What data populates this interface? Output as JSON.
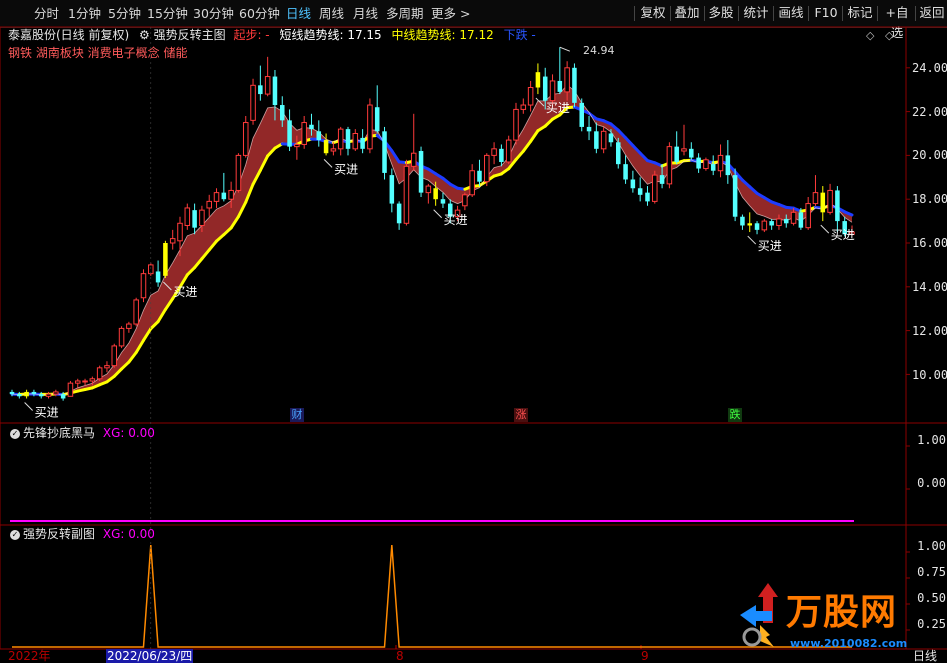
{
  "toolbar": {
    "periods": [
      "分时",
      "1分钟",
      "5分钟",
      "15分钟",
      "30分钟",
      "60分钟",
      "日线",
      "周线",
      "月线",
      "多周期",
      "更多 >"
    ],
    "active_period": "日线",
    "right_buttons": [
      "复权",
      "叠加",
      "多股",
      "统计",
      "画线",
      "F10",
      "标记",
      "+自选",
      "返回"
    ]
  },
  "main_panel": {
    "stock": "泰嘉股份(日线 前复权)",
    "indicator": "强势反转主图",
    "start_label": "起步: -",
    "short_trend": "短线趋势线: 17.15",
    "mid_trend": "中线趋势线: 17.12",
    "direction": "下跌 -",
    "concepts": "钢铁 湖南板块 消费电子概念 储能",
    "y_axis": [
      "24.00",
      "22.00",
      "20.00",
      "18.00",
      "16.00",
      "14.00",
      "12.00",
      "10.00"
    ],
    "peak_label": "24.94",
    "buy_label": "买进",
    "news_marks": [
      "财",
      "涨",
      "跌"
    ]
  },
  "sub_panel_1": {
    "title": "先锋抄底黑马",
    "xg": "XG: 0.00",
    "y_axis": [
      "1.00",
      "0.00"
    ]
  },
  "sub_panel_2": {
    "title": "强势反转副图",
    "xg": "XG: 0.00",
    "y_axis": [
      "1.00",
      "0.75",
      "0.50",
      "0.25"
    ]
  },
  "x_axis": [
    "2022年",
    "2022/06/23/四",
    "8",
    "9"
  ],
  "footer_right": "日线",
  "watermark": {
    "brand": "万股网",
    "url": "www.2010082.com"
  },
  "colors": {
    "up": "#ff3b3b",
    "down": "#54ffff",
    "buy_bar": "#ffff00",
    "trend_up": "#ffff00",
    "trend_down": "#1e3cff",
    "band": "#9a2a2a",
    "magenta": "#ff00ff",
    "orange": "#ff8a00"
  },
  "chart_data": {
    "type": "candlestick",
    "title": "泰嘉股份(日线 前复权)",
    "ylim": [
      9,
      25
    ],
    "ohlc": [
      [
        9.2,
        9.3,
        9.0,
        9.1
      ],
      [
        9.1,
        9.2,
        8.9,
        9.0
      ],
      [
        9.0,
        9.3,
        8.9,
        9.2
      ],
      [
        9.2,
        9.3,
        9.0,
        9.1
      ],
      [
        9.1,
        9.2,
        8.9,
        9.0
      ],
      [
        9.0,
        9.2,
        8.9,
        9.1
      ],
      [
        9.1,
        9.3,
        9.0,
        9.2
      ],
      [
        9.1,
        9.2,
        8.8,
        8.9
      ],
      [
        9.0,
        9.7,
        9.0,
        9.6
      ],
      [
        9.6,
        9.8,
        9.4,
        9.7
      ],
      [
        9.7,
        9.8,
        9.5,
        9.7
      ],
      [
        9.7,
        9.9,
        9.5,
        9.8
      ],
      [
        9.8,
        10.4,
        9.7,
        10.3
      ],
      [
        10.3,
        10.6,
        10.1,
        10.4
      ],
      [
        10.4,
        11.4,
        10.3,
        11.3
      ],
      [
        11.3,
        12.2,
        11.2,
        12.1
      ],
      [
        12.1,
        12.4,
        11.9,
        12.3
      ],
      [
        12.3,
        13.5,
        12.2,
        13.4
      ],
      [
        13.5,
        14.8,
        13.3,
        14.6
      ],
      [
        14.6,
        15.1,
        14.5,
        15.0
      ],
      [
        14.7,
        15.2,
        14.0,
        14.2
      ],
      [
        14.5,
        16.1,
        14.4,
        16.0
      ],
      [
        16.0,
        16.6,
        15.7,
        16.2
      ],
      [
        16.1,
        17.2,
        15.4,
        16.9
      ],
      [
        16.8,
        17.8,
        16.6,
        17.6
      ],
      [
        17.5,
        17.8,
        16.4,
        16.7
      ],
      [
        16.8,
        17.7,
        16.5,
        17.5
      ],
      [
        17.6,
        18.2,
        17.2,
        17.9
      ],
      [
        17.9,
        18.5,
        17.6,
        18.3
      ],
      [
        18.3,
        19.2,
        17.9,
        18.0
      ],
      [
        18.0,
        18.8,
        17.6,
        18.4
      ],
      [
        18.4,
        20.1,
        18.3,
        20.0
      ],
      [
        20.0,
        21.8,
        19.9,
        21.5
      ],
      [
        21.6,
        23.5,
        21.4,
        23.2
      ],
      [
        23.2,
        24.1,
        22.5,
        22.8
      ],
      [
        22.8,
        24.5,
        22.7,
        23.6
      ],
      [
        23.6,
        23.9,
        21.6,
        22.3
      ],
      [
        22.3,
        22.7,
        21.3,
        21.6
      ],
      [
        21.6,
        22.1,
        20.2,
        20.4
      ],
      [
        20.4,
        20.9,
        19.8,
        20.5
      ],
      [
        20.5,
        21.8,
        20.3,
        21.5
      ],
      [
        21.4,
        21.9,
        20.9,
        21.2
      ],
      [
        21.1,
        21.6,
        20.4,
        20.7
      ],
      [
        20.7,
        21.0,
        20.0,
        20.1
      ],
      [
        20.2,
        20.6,
        20.0,
        20.3
      ],
      [
        20.3,
        21.3,
        20.0,
        21.2
      ],
      [
        21.2,
        21.3,
        20.0,
        20.3
      ],
      [
        20.3,
        21.2,
        20.2,
        21.0
      ],
      [
        20.8,
        21.2,
        20.1,
        20.3
      ],
      [
        20.3,
        22.6,
        20.1,
        22.3
      ],
      [
        22.2,
        23.2,
        21.0,
        21.1
      ],
      [
        21.1,
        21.3,
        18.9,
        19.2
      ],
      [
        19.1,
        19.4,
        17.4,
        17.8
      ],
      [
        17.8,
        17.9,
        16.6,
        16.9
      ],
      [
        16.9,
        19.8,
        16.8,
        19.5
      ],
      [
        19.5,
        21.9,
        19.3,
        20.1
      ],
      [
        20.2,
        20.4,
        18.1,
        18.3
      ],
      [
        18.3,
        18.7,
        17.8,
        18.6
      ],
      [
        18.5,
        18.8,
        17.7,
        18.0
      ],
      [
        18.0,
        18.3,
        17.6,
        17.8
      ],
      [
        17.8,
        18.0,
        16.9,
        17.2
      ],
      [
        17.2,
        17.7,
        17.0,
        17.5
      ],
      [
        17.7,
        18.3,
        17.5,
        18.2
      ],
      [
        18.2,
        19.6,
        18.1,
        19.3
      ],
      [
        19.3,
        19.8,
        18.6,
        18.8
      ],
      [
        18.8,
        20.1,
        18.6,
        20.0
      ],
      [
        20.0,
        20.6,
        19.6,
        20.3
      ],
      [
        20.3,
        20.5,
        19.5,
        19.7
      ],
      [
        19.7,
        20.9,
        19.6,
        20.7
      ],
      [
        20.7,
        22.4,
        20.5,
        22.1
      ],
      [
        22.1,
        22.6,
        21.9,
        22.3
      ],
      [
        22.3,
        23.4,
        22.0,
        23.1
      ],
      [
        23.1,
        24.2,
        22.8,
        23.8
      ],
      [
        23.6,
        24.0,
        22.1,
        22.5
      ],
      [
        22.5,
        23.7,
        22.3,
        23.4
      ],
      [
        23.4,
        24.94,
        22.8,
        22.9
      ],
      [
        22.9,
        24.3,
        22.5,
        24.0
      ],
      [
        24.0,
        24.2,
        22.2,
        22.4
      ],
      [
        22.4,
        22.6,
        21.1,
        21.3
      ],
      [
        21.3,
        21.8,
        20.7,
        21.1
      ],
      [
        21.1,
        21.5,
        20.1,
        20.3
      ],
      [
        20.3,
        21.3,
        20.1,
        21.1
      ],
      [
        21.0,
        21.2,
        20.4,
        20.6
      ],
      [
        20.6,
        20.8,
        19.4,
        19.6
      ],
      [
        19.6,
        20.0,
        18.7,
        18.9
      ],
      [
        18.9,
        19.3,
        18.3,
        18.5
      ],
      [
        18.5,
        19.0,
        17.9,
        18.2
      ],
      [
        18.3,
        18.6,
        17.7,
        17.9
      ],
      [
        17.9,
        19.3,
        17.8,
        19.1
      ],
      [
        19.1,
        19.6,
        18.5,
        18.7
      ],
      [
        18.7,
        20.6,
        18.5,
        20.4
      ],
      [
        20.4,
        21.1,
        19.6,
        19.7
      ],
      [
        20.2,
        21.4,
        20.0,
        20.3
      ],
      [
        20.3,
        20.6,
        19.8,
        19.9
      ],
      [
        19.9,
        20.1,
        19.2,
        19.4
      ],
      [
        19.4,
        19.9,
        19.3,
        19.8
      ],
      [
        19.6,
        20.0,
        19.1,
        19.3
      ],
      [
        19.3,
        20.5,
        19.0,
        20.0
      ],
      [
        20.0,
        20.7,
        18.7,
        19.1
      ],
      [
        19.1,
        19.4,
        17.0,
        17.2
      ],
      [
        17.2,
        17.3,
        16.6,
        16.8
      ],
      [
        16.8,
        17.4,
        16.5,
        16.9
      ],
      [
        16.9,
        17.0,
        16.4,
        16.6
      ],
      [
        16.6,
        17.1,
        16.5,
        17.0
      ],
      [
        17.0,
        17.1,
        16.6,
        16.8
      ],
      [
        16.8,
        17.3,
        16.6,
        17.1
      ],
      [
        17.1,
        17.3,
        16.7,
        16.9
      ],
      [
        16.9,
        17.6,
        16.8,
        17.4
      ],
      [
        17.4,
        17.6,
        16.6,
        16.7
      ],
      [
        16.7,
        18.1,
        16.6,
        17.8
      ],
      [
        17.8,
        19.1,
        17.7,
        18.3
      ],
      [
        18.3,
        18.6,
        17.0,
        17.4
      ],
      [
        17.4,
        18.7,
        17.3,
        18.4
      ],
      [
        18.4,
        18.6,
        16.5,
        17.0
      ],
      [
        17.0,
        17.2,
        16.3,
        16.4
      ],
      [
        16.4,
        16.8,
        16.3,
        16.5
      ]
    ],
    "buy_signal_indices": [
      2,
      21,
      43,
      58,
      72,
      101,
      111
    ],
    "sub2_spikes_at": [
      19,
      52
    ]
  }
}
